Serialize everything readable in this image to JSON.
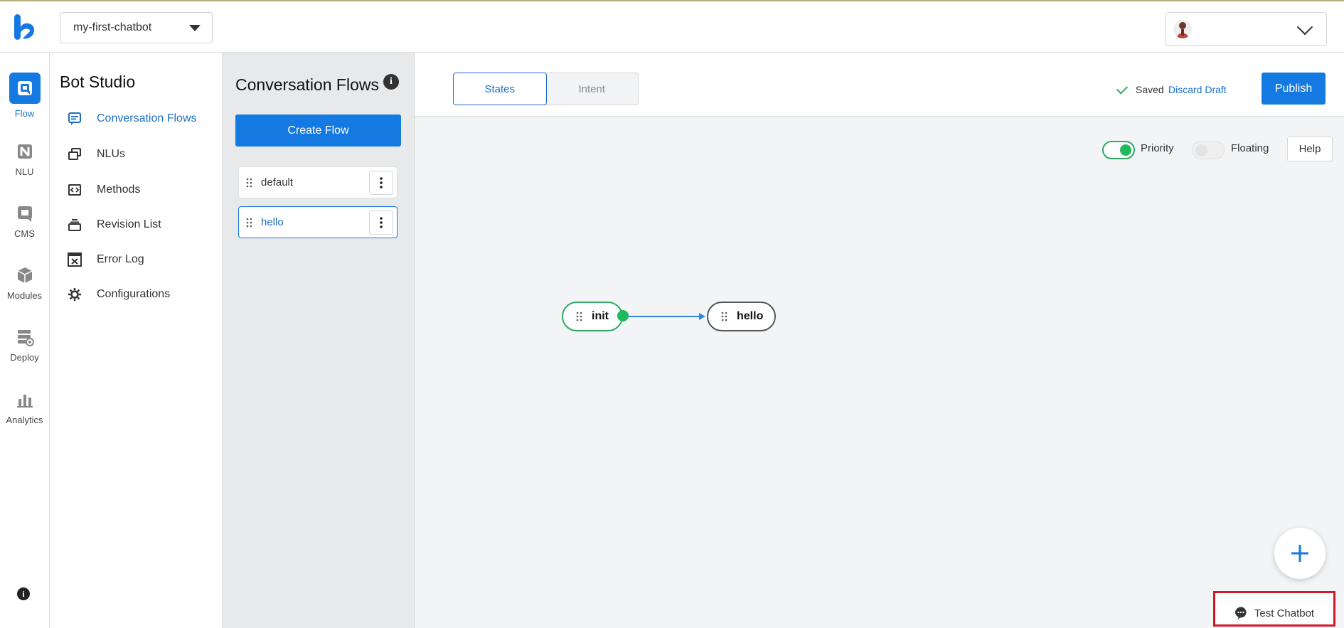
{
  "header": {
    "bot_selector": {
      "value": "my-first-chatbot"
    },
    "user_menu": {
      "avatar_icon": "user-avatar-icon"
    }
  },
  "rail": {
    "items": [
      {
        "label": "Flow",
        "icon": "flow-icon",
        "active": true
      },
      {
        "label": "NLU",
        "icon": "nlu-icon"
      },
      {
        "label": "CMS",
        "icon": "cms-icon"
      },
      {
        "label": "Modules",
        "icon": "cube-icon"
      },
      {
        "label": "Deploy",
        "icon": "deploy-icon"
      },
      {
        "label": "Analytics",
        "icon": "bar-chart-icon"
      }
    ],
    "info_glyph": "i"
  },
  "studio": {
    "title": "Bot Studio",
    "items": [
      {
        "label": "Conversation Flows",
        "icon": "chat-icon",
        "active": true
      },
      {
        "label": "NLUs",
        "icon": "nlu-cards-icon"
      },
      {
        "label": "Methods",
        "icon": "code-icon"
      },
      {
        "label": "Revision List",
        "icon": "stack-icon"
      },
      {
        "label": "Error Log",
        "icon": "error-log-icon"
      },
      {
        "label": "Configurations",
        "icon": "gear-icon"
      }
    ]
  },
  "flows_panel": {
    "title": "Conversation Flows",
    "info_glyph": "i",
    "create_label": "Create Flow",
    "flows": [
      {
        "name": "default",
        "active": false
      },
      {
        "name": "hello",
        "active": true
      }
    ]
  },
  "editor": {
    "tabs": [
      {
        "label": "States",
        "active": true
      },
      {
        "label": "Intent",
        "active": false
      }
    ],
    "saved_label": "Saved",
    "discard_label": "Discard Draft",
    "publish_label": "Publish",
    "priority_label": "Priority",
    "priority_on": true,
    "floating_label": "Floating",
    "floating_on": false,
    "help_label": "Help",
    "nodes": [
      {
        "label": "init"
      },
      {
        "label": "hello"
      }
    ],
    "test_chatbot_label": "Test Chatbot"
  },
  "colors": {
    "accent": "#1479e0",
    "link": "#1d6fc4",
    "success": "#1fb85a",
    "highlight_box": "#d3182a"
  }
}
